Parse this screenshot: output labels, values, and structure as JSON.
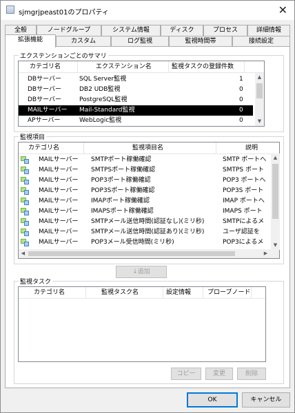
{
  "window": {
    "title": "sjmgrjpeast01のプロパティ"
  },
  "tabs": {
    "row1": [
      "全般",
      "ノードグループ",
      "システム情報",
      "ディスク",
      "プロセス",
      "詳細情報"
    ],
    "row2": [
      "拡張機能",
      "カスタム",
      "ログ監視",
      "監視時間帯",
      "接続設定"
    ]
  },
  "summary": {
    "title": "エクステンションごとのサマリ",
    "columns": [
      "カテゴリ名",
      "エクステンション名",
      "監視タスクの登録件数"
    ],
    "rows": [
      {
        "category": "DBサーバー",
        "extension": "SQL Server監視",
        "count": "1"
      },
      {
        "category": "DBサーバー",
        "extension": "DB2 UDB監視",
        "count": "0"
      },
      {
        "category": "DBサーバー",
        "extension": "PostgreSQL監視",
        "count": "0"
      },
      {
        "category": "MAILサーバー",
        "extension": "Mail-Standard監視",
        "count": "0"
      },
      {
        "category": "APサーバー",
        "extension": "WebLogic監視",
        "count": "0"
      }
    ]
  },
  "items": {
    "title": "監視項目",
    "columns": [
      "カテゴリ名",
      "監視項目名",
      "説明"
    ],
    "rows": [
      {
        "category": "MAILサーバー",
        "name": "SMTPポート稼働確認",
        "desc": "SMTP ポートへ"
      },
      {
        "category": "MAILサーバー",
        "name": "SMTPSポート稼働確認",
        "desc": "SMTPS ポート"
      },
      {
        "category": "MAILサーバー",
        "name": "POP3ポート稼働確認",
        "desc": "POP3 ポートへ"
      },
      {
        "category": "MAILサーバー",
        "name": "POP3Sポート稼働確認",
        "desc": "POP3S ポート"
      },
      {
        "category": "MAILサーバー",
        "name": "IMAPポート稼働確認",
        "desc": "IMAP ポートへ"
      },
      {
        "category": "MAILサーバー",
        "name": "IMAPSポート稼働確認",
        "desc": "IMAPS ポート"
      },
      {
        "category": "MAILサーバー",
        "name": "SMTPメール送信時間(認証なし)(ミリ秒)",
        "desc": "SMTPによるメ"
      },
      {
        "category": "MAILサーバー",
        "name": "SMTPメール送信時間(認証あり)(ミリ秒)",
        "desc": "ユーザ認証を"
      },
      {
        "category": "MAILサーバー",
        "name": "POP3メール受信時間(ミリ秒)",
        "desc": "POP3によるメ"
      }
    ]
  },
  "add_button": "↓追加",
  "tasks": {
    "title": "監視タスク",
    "columns": [
      "カテゴリ名",
      "監視タスク名",
      "設定情報",
      "プローブノード"
    ]
  },
  "task_buttons": {
    "copy": "コピー",
    "change": "変更",
    "delete": "削除"
  },
  "footer": {
    "ok": "OK",
    "cancel": "キャンセル"
  },
  "colors": {
    "selection": "#000000",
    "default_border": "#0078d7",
    "icon_green": "#6bb536",
    "icon_blue": "#3d7fc6"
  }
}
